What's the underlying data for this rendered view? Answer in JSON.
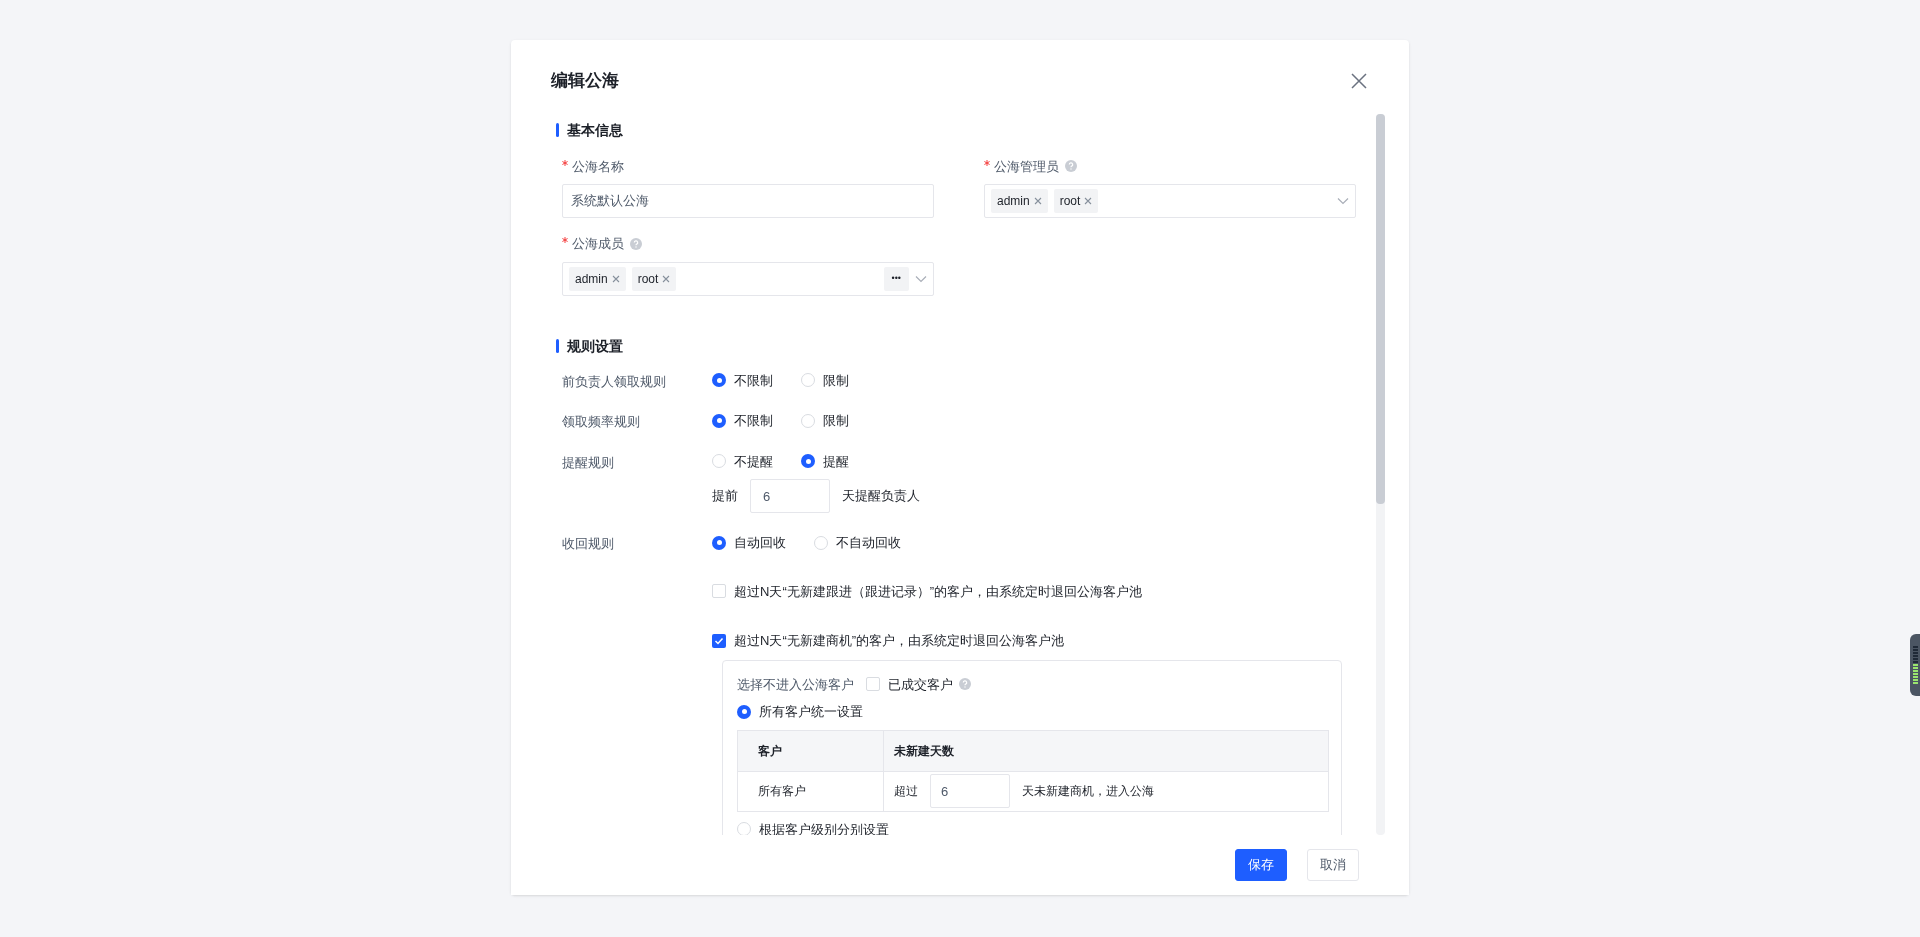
{
  "dialog": {
    "title": "编辑公海"
  },
  "basic": {
    "heading": "基本信息",
    "name_field": {
      "label": "公海名称",
      "required": true,
      "value": "系统默认公海"
    },
    "admins_field": {
      "label": "公海管理员",
      "required": true,
      "help": true,
      "tags": [
        "admin",
        "root"
      ]
    },
    "members_field": {
      "label": "公海成员",
      "required": true,
      "help": true,
      "tags": [
        "admin",
        "root"
      ],
      "more": "•••"
    }
  },
  "rules": {
    "heading": "规则设置",
    "rows": [
      {
        "label": "前负责人领取规则",
        "options": [
          {
            "label": "不限制",
            "selected": true
          },
          {
            "label": "限制",
            "selected": false
          }
        ]
      },
      {
        "label": "领取频率规则",
        "options": [
          {
            "label": "不限制",
            "selected": true
          },
          {
            "label": "限制",
            "selected": false
          }
        ]
      },
      {
        "label": "提醒规则",
        "options": [
          {
            "label": "不提醒",
            "selected": false
          },
          {
            "label": "提醒",
            "selected": true
          }
        ],
        "extra": {
          "prefix": "提前",
          "value": "6",
          "suffix": "天提醒负责人"
        }
      },
      {
        "label": "收回规则",
        "options": [
          {
            "label": "自动回收",
            "selected": true
          },
          {
            "label": "不自动回收",
            "selected": false
          }
        ]
      }
    ],
    "conditions": [
      {
        "label": "超过N天“无新建跟进（跟进记录）”的客户，由系统定时退回公海客户池",
        "checked": false
      },
      {
        "label": "超过N天“无新建商机”的客户，由系统定时退回公海客户池",
        "checked": true,
        "panel": {
          "exclude_label": "选择不进入公海客户",
          "exclude_option": {
            "label": "已成交客户",
            "checked": false
          },
          "modes": [
            {
              "label": "所有客户统一设置",
              "selected": true,
              "table": {
                "columns": [
                  "客户",
                  "未新建天数"
                ],
                "rows": [
                  {
                    "customer": "所有客户",
                    "prefix": "超过",
                    "value": "6",
                    "suffix": "天未新建商机，进入公海"
                  }
                ]
              }
            },
            {
              "label": "根据客户级别分别设置",
              "selected": false
            }
          ]
        }
      }
    ]
  },
  "footer": {
    "buttons": [
      {
        "label": "保存",
        "kind": "primary"
      },
      {
        "label": "取消",
        "kind": "default"
      }
    ]
  }
}
